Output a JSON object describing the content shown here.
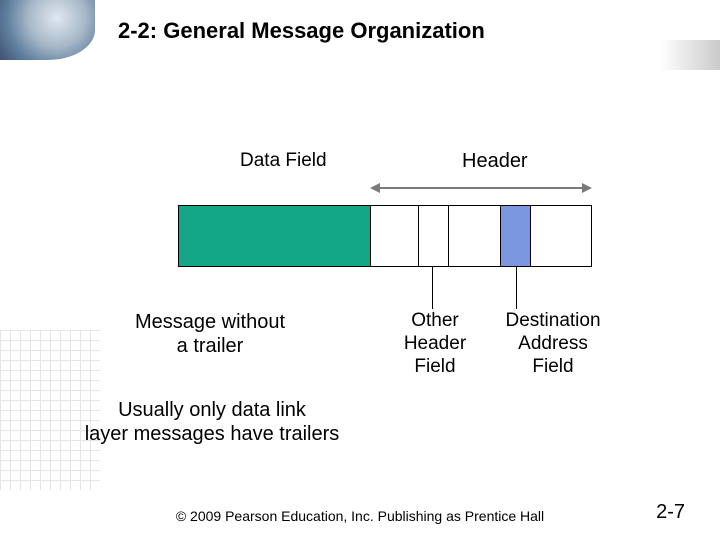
{
  "title": "2-2: General Message Organization",
  "labels": {
    "data_field": "Data Field",
    "header": "Header",
    "other_header_field": "Other\nHeader\nField",
    "destination_address_field": "Destination\nAddress\nField",
    "message_without_trailer": "Message without\na trailer",
    "usually_note": "Usually only data link\nlayer messages have trailers"
  },
  "footer": {
    "copyright": "© 2009 Pearson Education, Inc.  Publishing as Prentice Hall",
    "page": "2-7"
  },
  "colors": {
    "data_segment": "#13a787",
    "dest_segment": "#7a97df",
    "arrow": "#7a7a7a"
  }
}
